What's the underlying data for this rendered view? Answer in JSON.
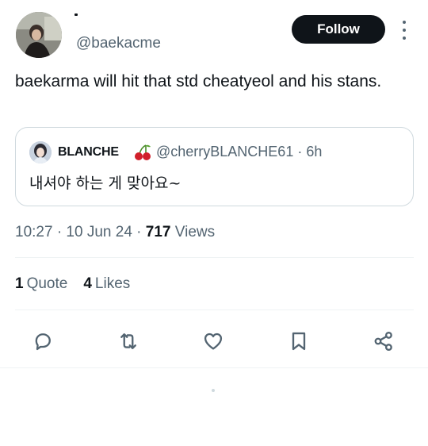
{
  "header": {
    "handle": "@baekacme",
    "follow_label": "Follow"
  },
  "tweet": {
    "text": "baekarma will hit that std cheatyeol and his stans."
  },
  "quote": {
    "name": "BLANCHE",
    "handle_time": "@cherryBLANCHE61 · 6h",
    "text": "내셔야 하는 게 맞아요~"
  },
  "meta": {
    "time_date": "10:27 · 10 Jun 24 · ",
    "views_count": "717",
    "views_label": " Views"
  },
  "stats": {
    "quotes_count": "1",
    "quotes_label": "Quote",
    "likes_count": "4",
    "likes_label": "Likes"
  },
  "icons": {
    "reply": "reply-icon",
    "retweet": "retweet-icon",
    "like": "heart-icon",
    "bookmark": "bookmark-icon",
    "share": "share-icon",
    "more": "more-vertical-icon"
  },
  "colors": {
    "text": "#0f1419",
    "secondary": "#536471",
    "border": "#cfd9de",
    "follow_bg": "#0f1419"
  }
}
